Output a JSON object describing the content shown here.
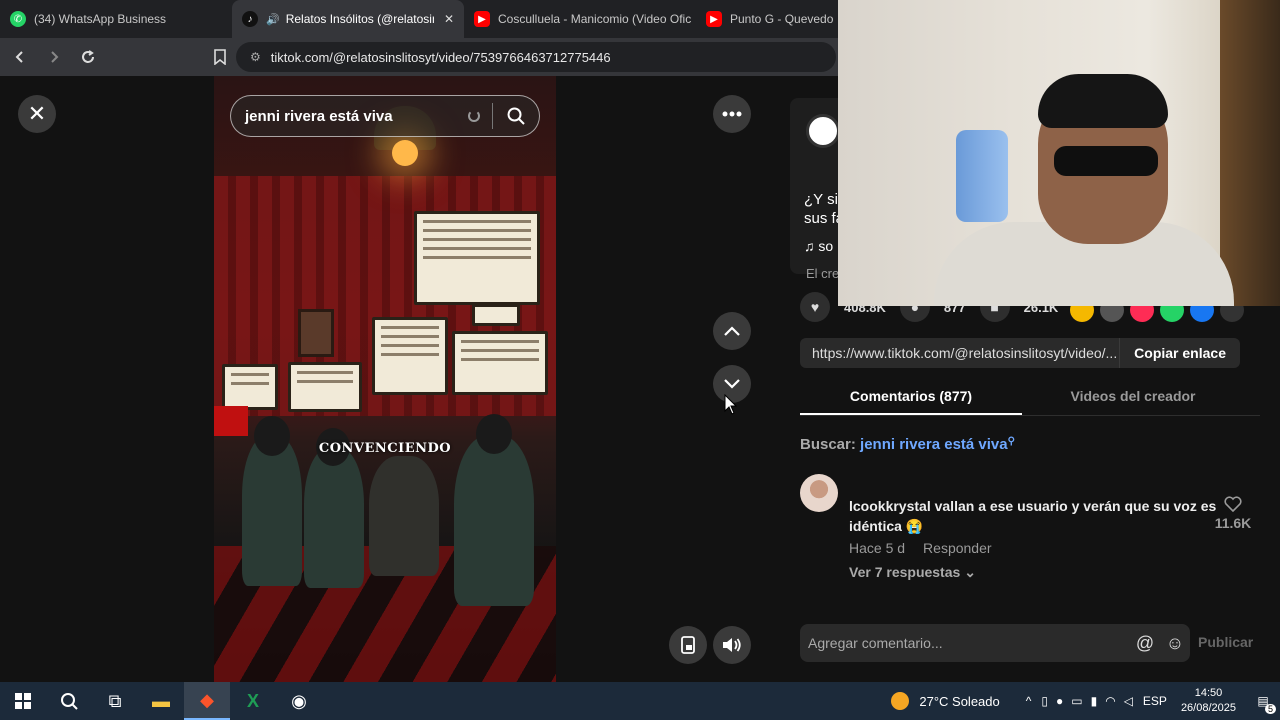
{
  "browser": {
    "tabs": [
      {
        "label": "(34) WhatsApp Business",
        "icon": "whatsapp-icon",
        "color": "#25d366"
      },
      {
        "label": "Relatos Insólitos (@relatosinsl",
        "icon": "tiktok-icon",
        "color": "#ffffff"
      },
      {
        "label": "Cosculluela - Manicomio (Video Ofic",
        "icon": "youtube-icon",
        "color": "#ff0000"
      },
      {
        "label": "Punto G - Quevedo - V",
        "icon": "youtube-icon",
        "color": "#ff0000"
      }
    ],
    "url": "tiktok.com/@relatosinslitosyt/video/7539766463712775446"
  },
  "player": {
    "search_query": "jenni rivera está viva",
    "caption": "CONVENCIENDO"
  },
  "panel": {
    "description_line1": "¿Y si",
    "description_line2": "sus fa",
    "music_prefix": "so",
    "creator_prefix": "El crea",
    "likes": "408.8K",
    "comments_count": "877",
    "saves": "26.1K",
    "link_url": "https://www.tiktok.com/@relatosinslitosyt/video/...",
    "copy_label": "Copiar enlace",
    "tab_comments": "Comentarios (877)",
    "tab_videos": "Videos del creador",
    "search_label": "Buscar:",
    "search_keyword": "jenni rivera está viva",
    "comment": {
      "username": "lcookkrystal",
      "text": "vallan a ese usuario y verán que su voz es idéntica 😭",
      "time": "Hace 5 d",
      "reply": "Responder",
      "replies": "Ver 7 respuestas",
      "likes": "11.6K"
    },
    "compose_placeholder": "Agregar comentario...",
    "publish_label": "Publicar"
  },
  "taskbar": {
    "weather": "27°C  Soleado",
    "lang": "ESP",
    "time": "14:50",
    "date": "26/08/2025",
    "notifications": "5"
  },
  "colors": {
    "link": "#6fa8ff",
    "taskbar": "#1c2a3a",
    "tab_active": "#35363a"
  }
}
